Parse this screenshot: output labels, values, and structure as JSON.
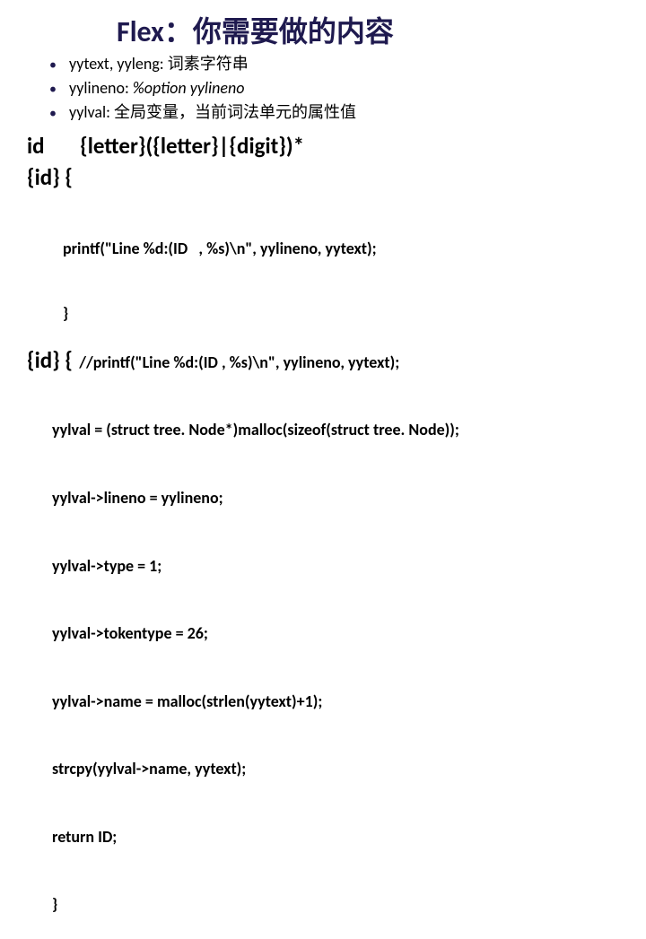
{
  "title": "Flex：你需要做的内容",
  "bullets": [
    {
      "name": "yytext, yyleng:",
      "desc": "词素字符串",
      "italic": false
    },
    {
      "name": "yylineno:",
      "desc": "%option yylineno",
      "italic": true
    },
    {
      "name": "yylval:",
      "desc": "全局变量，当前词法单元的属性值",
      "italic": false
    }
  ],
  "def_id_label": "id",
  "def_id_regex": "{letter}({letter}|{digit})*",
  "rule1_open": "{id}   {",
  "rule1_line1": "printf(\"Line %d:(ID   , %s)\\n\", yylineno, yytext);",
  "rule1_line2": "}",
  "rule2_label": "{id}   {",
  "rule2_comment": "//printf(\"Line %d:(ID   , %s)\\n\", yylineno, yytext);",
  "body2_lines": [
    "yylval = (struct tree. Node*)malloc(sizeof(struct tree. Node));",
    "yylval->lineno = yylineno;",
    "yylval->type = 1;",
    "yylval->tokentype = 26;",
    "yylval->name = malloc(strlen(yytext)+1);",
    "strcpy(yylval->name, yytext);",
    "return ID;",
    "}"
  ]
}
